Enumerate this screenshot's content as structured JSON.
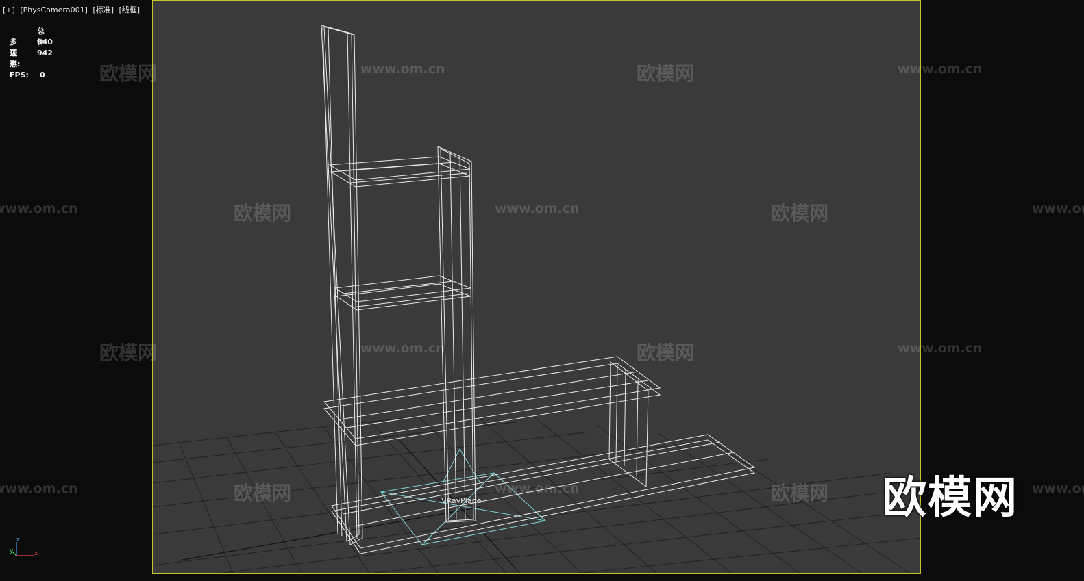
{
  "viewport_header": {
    "menu": "[+]",
    "camera": "[PhysCamera001]",
    "shading_standard": "[标准]",
    "shading_mode": "[线框]"
  },
  "stats": {
    "header": "总计",
    "polygons_label": "多边形:",
    "polygons_value": "840",
    "vertices_label": "顶点:",
    "vertices_value": "942",
    "fps_label": "FPS:",
    "fps_value": "0"
  },
  "scene": {
    "object_label": "VRayPlane"
  },
  "watermark": {
    "cn_text": "欧模网",
    "url_text": "www.om.cn",
    "logo_text": "欧模网"
  },
  "axis_gizmo": {
    "x": "x",
    "y": "y",
    "z": "z"
  },
  "colors": {
    "viewport_bg": "#3a3a3a",
    "viewport_border": "#c9c32a",
    "wireframe": "#ffffff",
    "grid": "#1e1e1e",
    "vray_plane": "#7fd3d8"
  }
}
